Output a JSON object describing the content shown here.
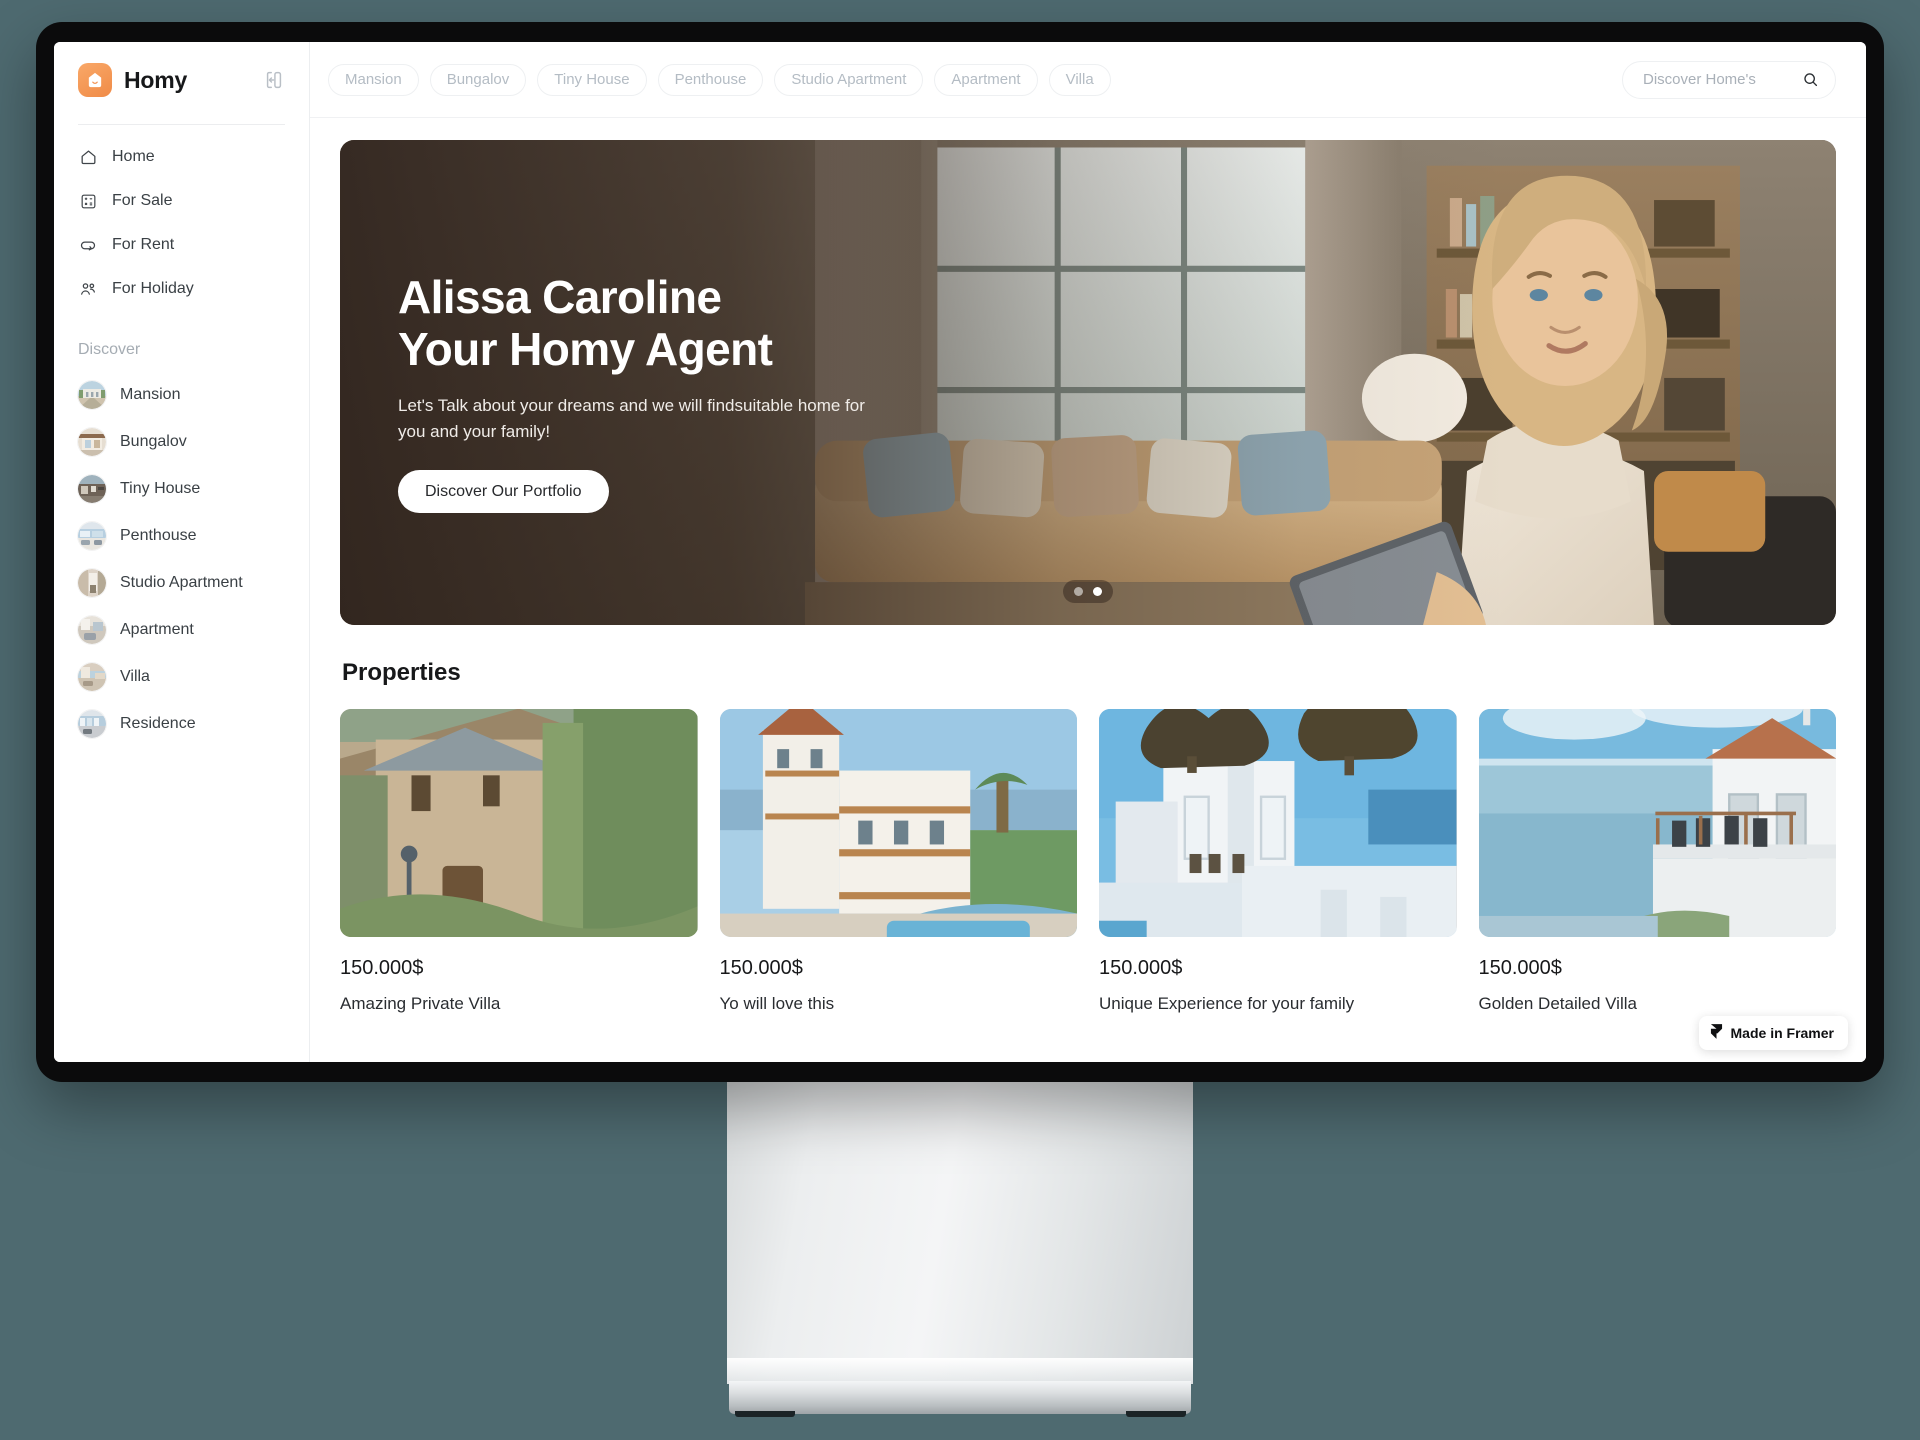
{
  "app": {
    "brand_name": "Homy",
    "logo_icon": "house-logo-icon",
    "collapse_icon": "sidebar-collapse-icon"
  },
  "sidebar": {
    "nav": [
      {
        "label": "Home",
        "icon": "home-icon"
      },
      {
        "label": "For Sale",
        "icon": "for-sale-icon"
      },
      {
        "label": "For Rent",
        "icon": "for-rent-icon"
      },
      {
        "label": "For Holiday",
        "icon": "for-holiday-icon"
      }
    ],
    "discover_title": "Discover",
    "discover": [
      {
        "label": "Mansion"
      },
      {
        "label": "Bungalov"
      },
      {
        "label": "Tiny House"
      },
      {
        "label": "Penthouse"
      },
      {
        "label": "Studio Apartment"
      },
      {
        "label": "Apartment"
      },
      {
        "label": "Villa"
      },
      {
        "label": "Residence"
      }
    ]
  },
  "topbar": {
    "chips": [
      {
        "label": "Mansion"
      },
      {
        "label": "Bungalov"
      },
      {
        "label": "Tiny House"
      },
      {
        "label": "Penthouse"
      },
      {
        "label": "Studio Apartment"
      },
      {
        "label": "Apartment"
      },
      {
        "label": "Villa"
      }
    ],
    "search": {
      "placeholder": "Discover Home's",
      "value": "",
      "icon": "search-icon"
    }
  },
  "hero": {
    "heading": "Alissa Caroline\nYour Homy Agent",
    "subheading": "Let's Talk about your dreams and we will findsuitable home for you and your family!",
    "cta_label": "Discover Our Portfolio",
    "carousel": {
      "total": 2,
      "active_index": 1
    }
  },
  "properties": {
    "title": "Properties",
    "cards": [
      {
        "price": "150.000$",
        "name": "Amazing Private Villa"
      },
      {
        "price": "150.000$",
        "name": "Yo will love this"
      },
      {
        "price": "150.000$",
        "name": "Unique Experience for your family"
      },
      {
        "price": "150.000$",
        "name": "Golden Detailed Villa"
      }
    ]
  },
  "badge": {
    "label": "Made in Framer",
    "icon": "framer-logo-icon"
  },
  "colors": {
    "background": "#4e6a70",
    "brand_accent": "#f3914f",
    "text_primary": "#17181a",
    "text_muted": "#a5acb3",
    "chip_border": "#eef0f2"
  }
}
